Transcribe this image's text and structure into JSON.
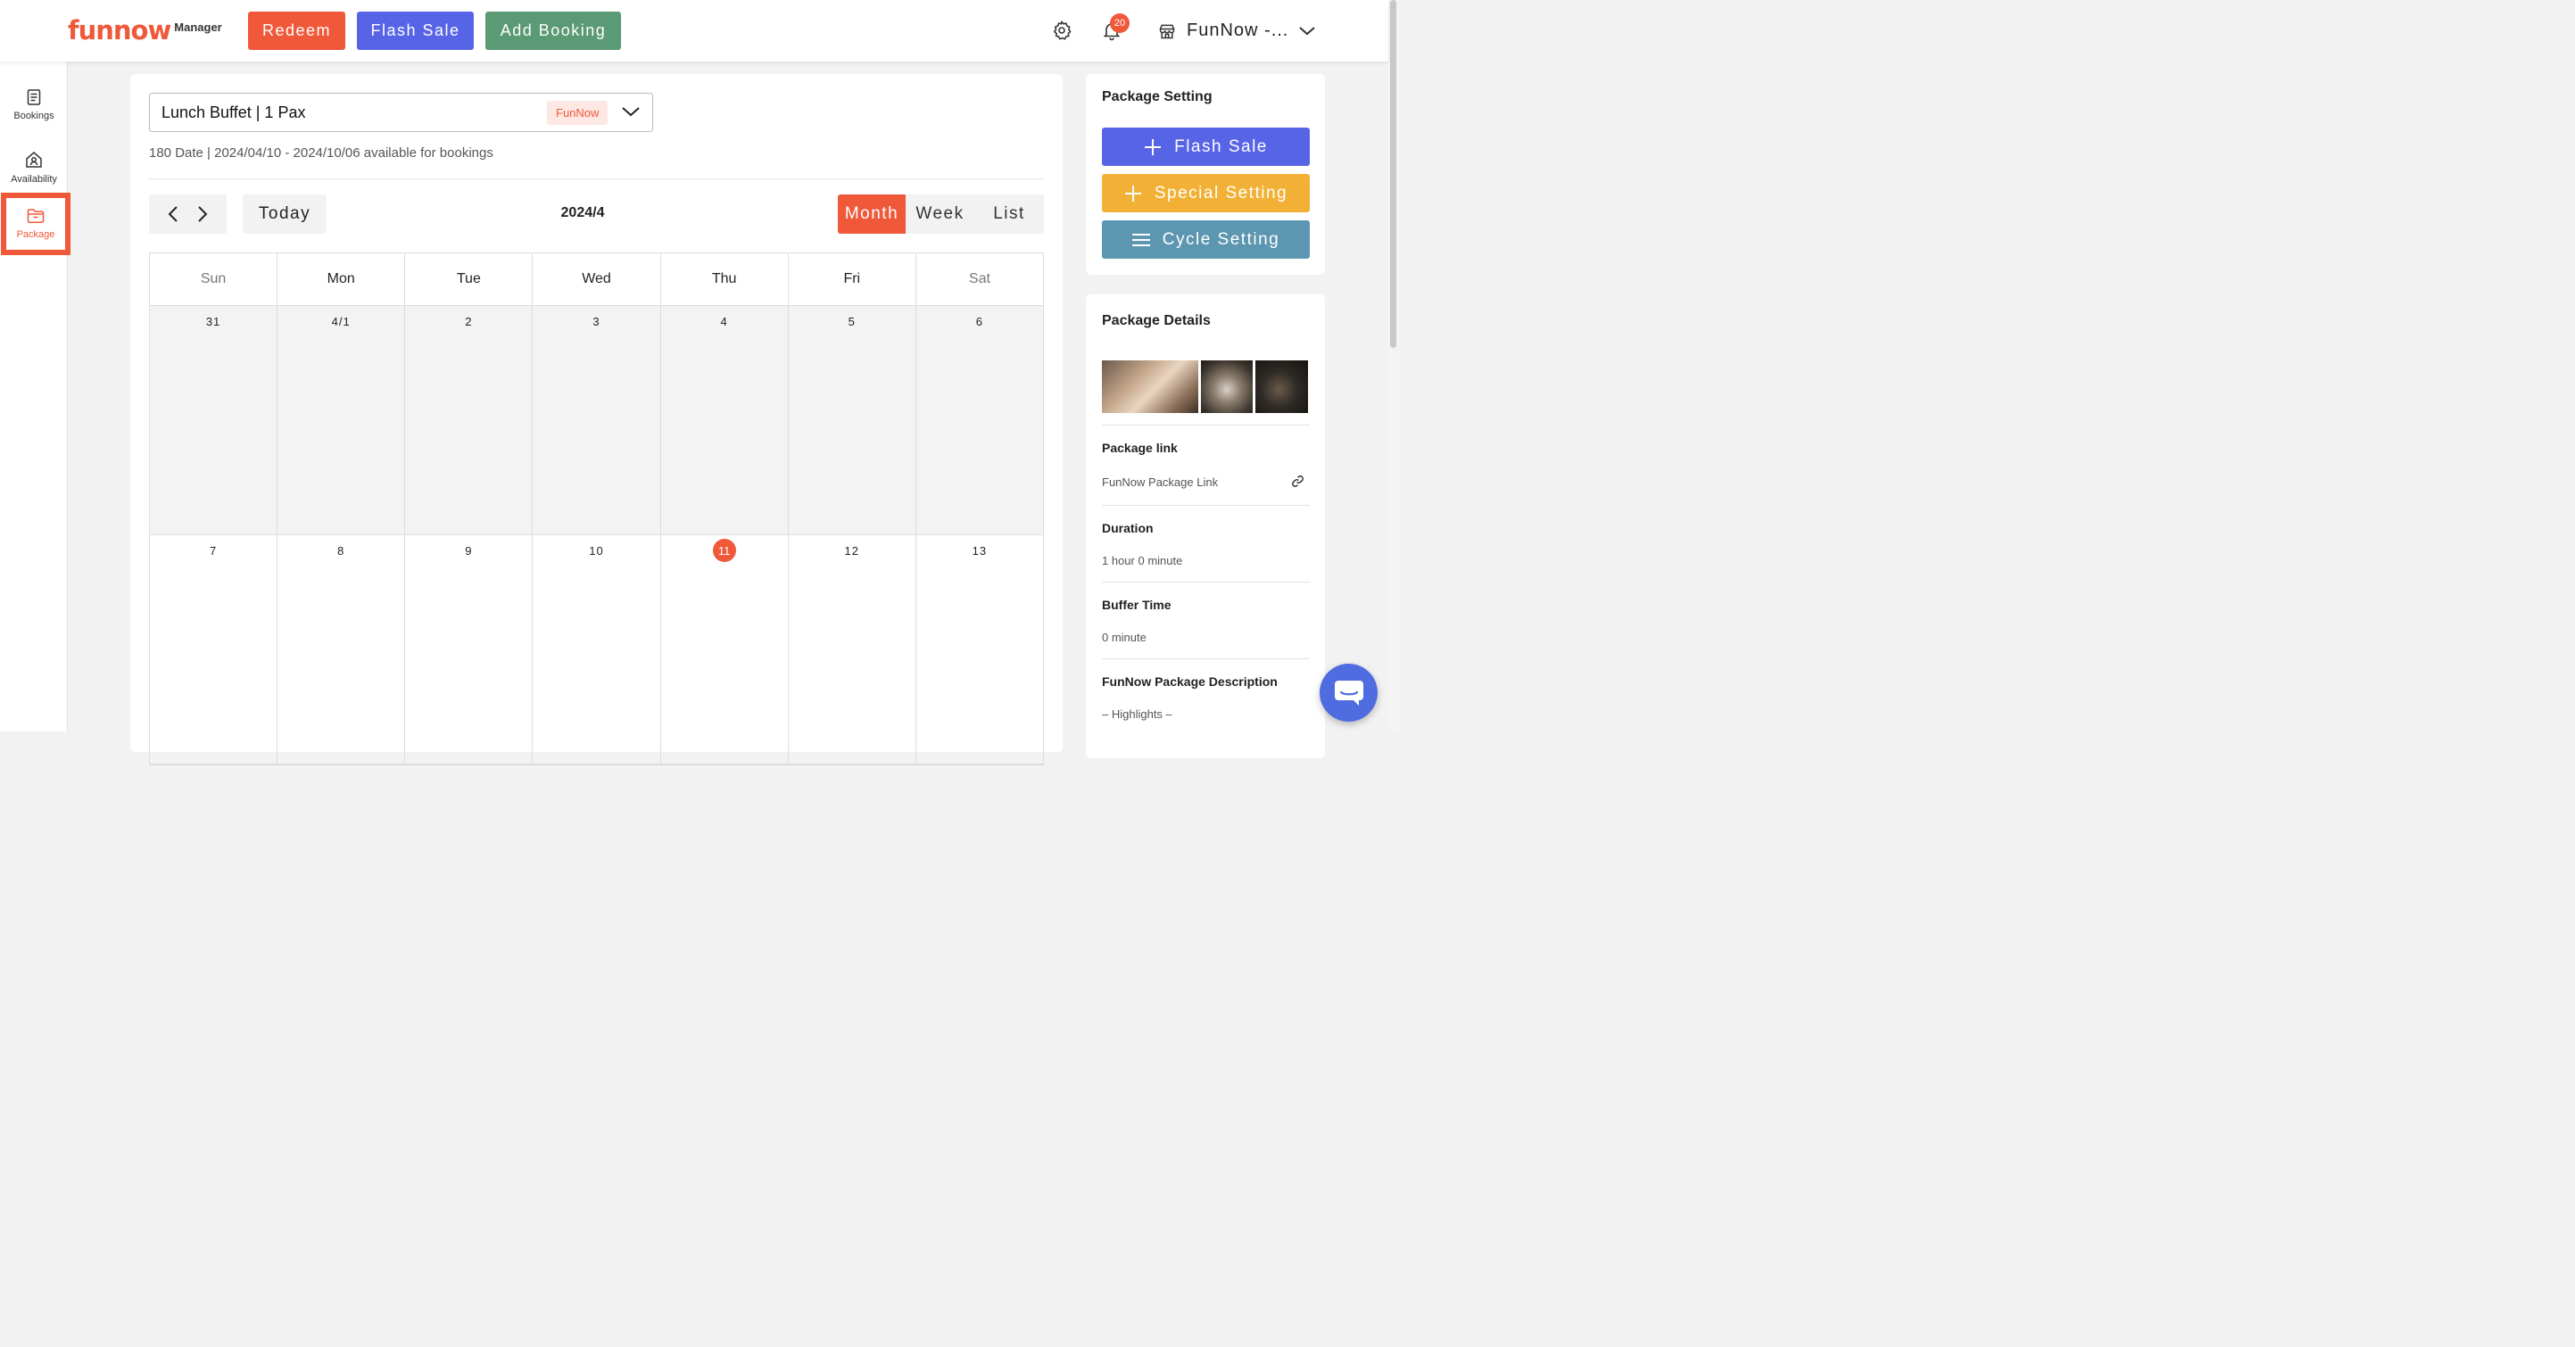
{
  "header": {
    "logo_text": "funnow",
    "logo_sub": "Manager",
    "buttons": {
      "redeem": "Redeem",
      "flash_sale": "Flash Sale",
      "add_booking": "Add Booking"
    },
    "notification_count": "20",
    "store_name": "FunNow -..."
  },
  "sidebar": {
    "items": [
      {
        "label": "Bookings",
        "icon": "document-icon"
      },
      {
        "label": "Availability",
        "icon": "house-icon"
      },
      {
        "label": "Package",
        "icon": "folder-icon",
        "active": true
      }
    ]
  },
  "main": {
    "package_select": {
      "value": "Lunch Buffet | 1 Pax",
      "tag": "FunNow"
    },
    "availability_text": "180 Date | 2024/04/10 - 2024/10/06 available for bookings",
    "toolbar": {
      "today": "Today",
      "title": "2024/4"
    },
    "views": [
      "Month",
      "Week",
      "List"
    ],
    "active_view": "Month",
    "calendar": {
      "weekdays": [
        "Sun",
        "Mon",
        "Tue",
        "Wed",
        "Thu",
        "Fri",
        "Sat"
      ],
      "weeks": [
        [
          "31",
          "4/1",
          "2",
          "3",
          "4",
          "5",
          "6"
        ],
        [
          "7",
          "8",
          "9",
          "10",
          "11",
          "12",
          "13"
        ]
      ],
      "today": "11"
    }
  },
  "package_setting": {
    "title": "Package Setting",
    "buttons": {
      "flash_sale": "Flash Sale",
      "special_setting": "Special Setting",
      "cycle_setting": "Cycle Setting"
    }
  },
  "package_details": {
    "title": "Package Details",
    "link_label": "Package link",
    "link_value": "FunNow Package Link",
    "duration_label": "Duration",
    "duration_value": "1 hour 0 minute",
    "buffer_label": "Buffer Time",
    "buffer_value": "0 minute",
    "description_label": "FunNow Package Description",
    "description_value": "– Highlights –"
  },
  "colors": {
    "brand": "#f0583a",
    "flash_sale": "#5864e6",
    "add_booking": "#5a9a74",
    "special_setting": "#f2b136",
    "cycle_setting": "#5d96b0"
  }
}
